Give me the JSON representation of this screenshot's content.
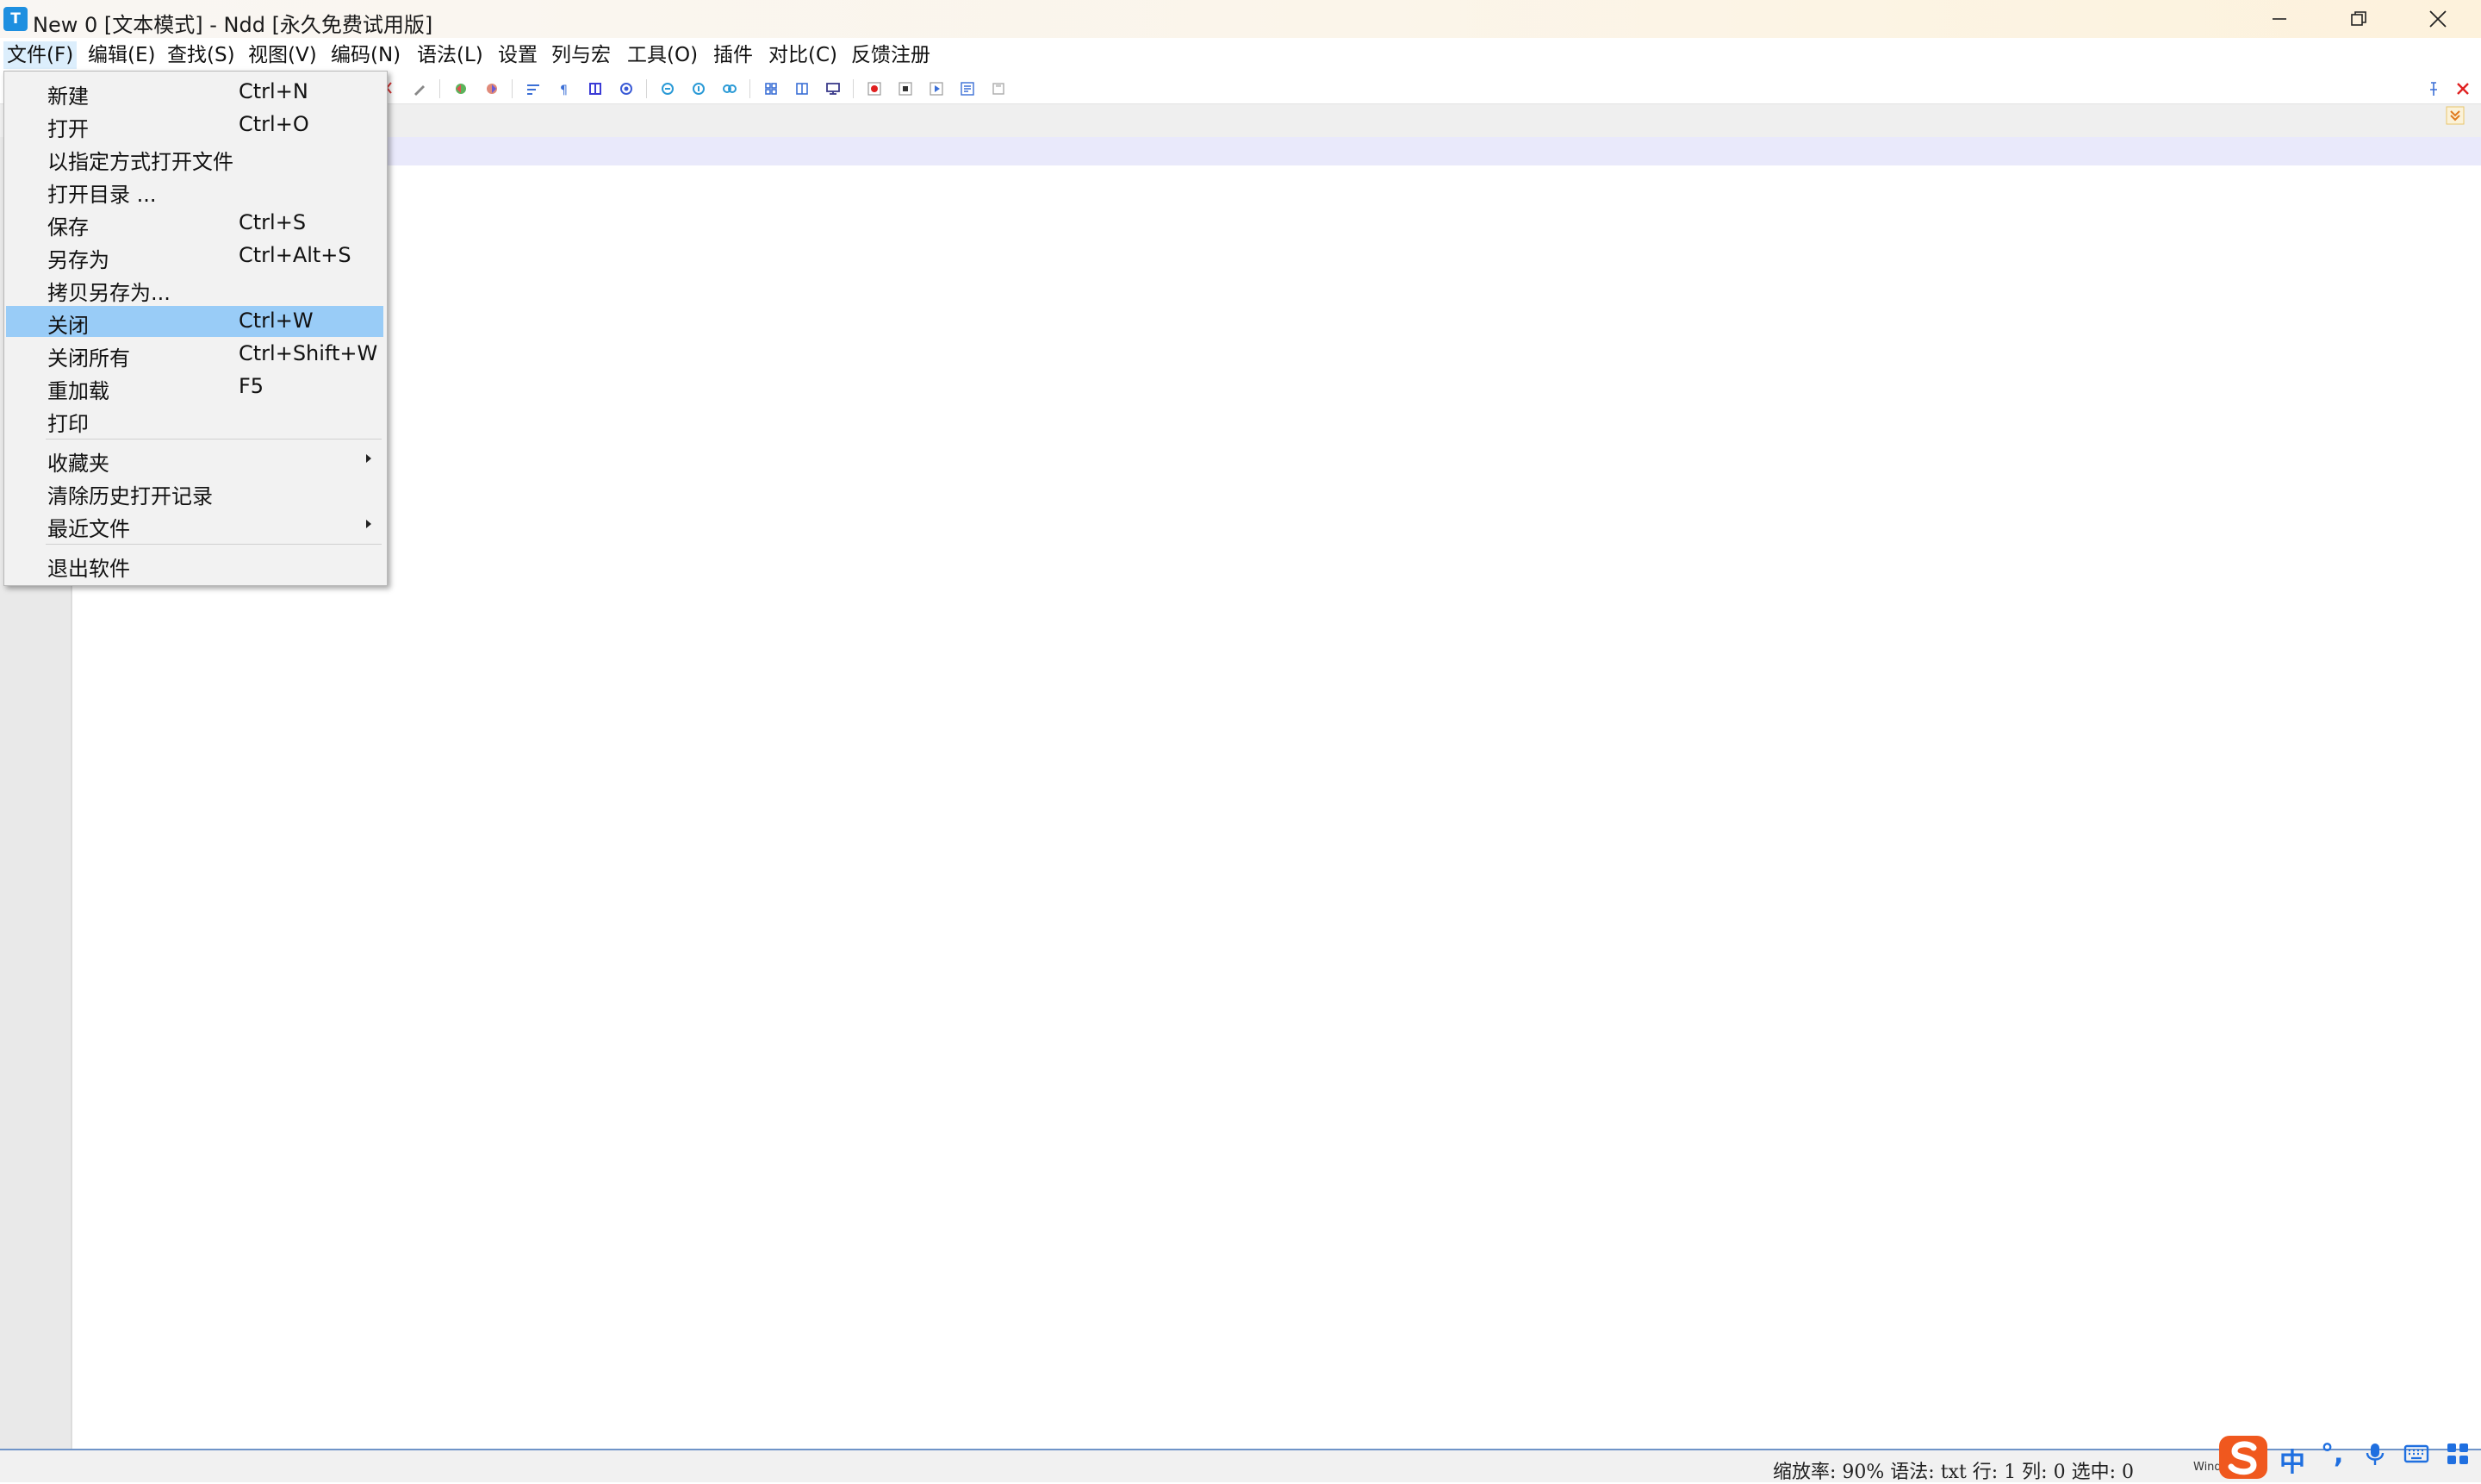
{
  "window": {
    "title": "New 0 [文本模式] - Ndd [永久免费试用版]",
    "icon_letter": "T",
    "minimize_icon": "minimize-icon",
    "maximize_icon": "restore-icon",
    "close_icon": "close-icon"
  },
  "menubar": {
    "items": [
      {
        "label": "文件(F)"
      },
      {
        "label": "编辑(E)"
      },
      {
        "label": "查找(S)"
      },
      {
        "label": "视图(V)"
      },
      {
        "label": "编码(N)"
      },
      {
        "label": "语法(L)"
      },
      {
        "label": "设置"
      },
      {
        "label": "列与宏"
      },
      {
        "label": "工具(O)"
      },
      {
        "label": "插件"
      },
      {
        "label": "对比(C)"
      },
      {
        "label": "反馈注册"
      }
    ]
  },
  "file_menu": {
    "items": [
      {
        "label": "新建",
        "shortcut": "Ctrl+N"
      },
      {
        "label": "打开",
        "shortcut": "Ctrl+O"
      },
      {
        "label": "以指定方式打开文件",
        "shortcut": ""
      },
      {
        "label": "打开目录 ...",
        "shortcut": ""
      },
      {
        "label": "保存",
        "shortcut": "Ctrl+S"
      },
      {
        "label": "另存为",
        "shortcut": "Ctrl+Alt+S"
      },
      {
        "label": "拷贝另存为...",
        "shortcut": ""
      },
      {
        "label": "关闭",
        "shortcut": "Ctrl+W",
        "highlighted": true
      },
      {
        "label": "关闭所有",
        "shortcut": "Ctrl+Shift+W"
      },
      {
        "label": "重加载",
        "shortcut": "F5"
      },
      {
        "label": "打印",
        "shortcut": ""
      },
      {
        "label": "收藏夹",
        "shortcut": "",
        "submenu": true
      },
      {
        "label": "清除历史打开记录",
        "shortcut": ""
      },
      {
        "label": "最近文件",
        "shortcut": "",
        "submenu": true
      },
      {
        "label": "退出软件",
        "shortcut": ""
      }
    ]
  },
  "statusbar": {
    "text": "缩放率: 90% 语法: txt 行: 1 列: 0 选中: 0",
    "overflow_text": "Wind"
  },
  "ime": {
    "logo_icon": "sogou-s-logo-icon",
    "mode_label": "中",
    "punct_label": "°,",
    "mic_icon": "microphone-icon",
    "keyboard_icon": "keyboard-icon",
    "toolbox_icon": "grid-icon"
  },
  "colors": {
    "menu_highlight": "#99ccf7",
    "current_line": "#e9e9fb",
    "statusbar_border": "#6f94c8",
    "ime_accent": "#1f6fe0",
    "sogou_orange": "#f0581e"
  }
}
